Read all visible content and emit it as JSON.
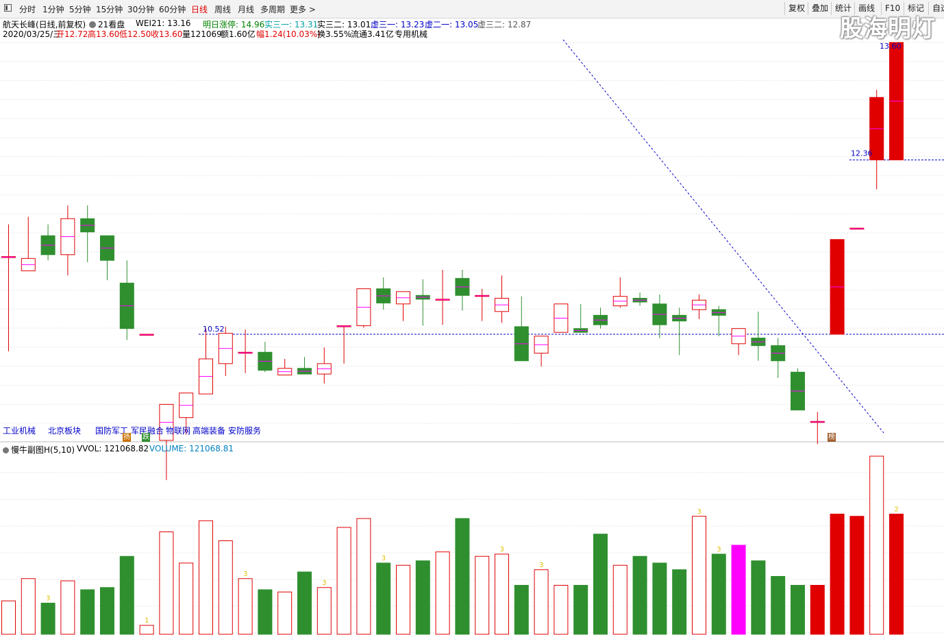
{
  "toolbar": {
    "periods": [
      "分时",
      "1分钟",
      "5分钟",
      "15分钟",
      "30分钟",
      "60分钟",
      "日线",
      "周线",
      "月线",
      "多周期",
      "更多 >"
    ],
    "active": "日线",
    "right": [
      "复权",
      "叠加",
      "统计",
      "画线",
      "F10",
      "标记",
      "自选"
    ]
  },
  "header": {
    "stock_title": "航天长峰(日线,前复权)",
    "board_btn": "21看盘",
    "wei": "WEI21: 13.16",
    "limit_up": "明日涨停: 14.96",
    "shi31": "实三一: 13.31",
    "shi32": "实三二: 13.01",
    "xu31": "虚三一: 13.23",
    "xu21": "虚二一: 13.05",
    "xu32": "虚三二: 12.87"
  },
  "quote": {
    "date": "2020/03/25/三",
    "open": "开12.72",
    "high": "高13.60",
    "low": "低12.50",
    "close": "收13.60",
    "vol": "量121069",
    "amount": "额1.60亿",
    "change": "幅1.24(10.03%)",
    "turnover": "换3.55%",
    "float": "流通3.41亿",
    "industry": "专用机械"
  },
  "chart_data": {
    "type": "candlestick",
    "price_labels": [
      "10.52",
      "12.36",
      "13.60"
    ],
    "candles": [
      {
        "o": 11.34,
        "h": 11.68,
        "l": 10.34,
        "c": 11.34
      },
      {
        "o": 11.19,
        "h": 11.76,
        "l": 11.48,
        "c": 11.32
      },
      {
        "o": 11.56,
        "h": 11.68,
        "l": 11.3,
        "c": 11.36
      },
      {
        "o": 11.36,
        "h": 11.88,
        "l": 11.14,
        "c": 11.74
      },
      {
        "o": 11.74,
        "h": 11.88,
        "l": 11.28,
        "c": 11.6
      },
      {
        "o": 11.56,
        "h": 11.56,
        "l": 11.09,
        "c": 11.3
      },
      {
        "o": 11.06,
        "h": 11.3,
        "l": 10.46,
        "c": 10.58
      },
      {
        "o": 10.52,
        "h": 10.52,
        "l": 10.52,
        "c": 10.52
      },
      {
        "o": 9.4,
        "h": 9.78,
        "l": 8.98,
        "c": 9.78
      },
      {
        "o": 9.64,
        "h": 9.9,
        "l": 9.46,
        "c": 9.9
      },
      {
        "o": 9.89,
        "h": 10.58,
        "l": 9.9,
        "c": 10.26
      },
      {
        "o": 10.21,
        "h": 10.6,
        "l": 10.08,
        "c": 10.53
      },
      {
        "o": 10.33,
        "h": 10.57,
        "l": 10.11,
        "c": 10.33
      },
      {
        "o": 10.33,
        "h": 10.44,
        "l": 10.12,
        "c": 10.14
      },
      {
        "o": 10.09,
        "h": 10.26,
        "l": 10.18,
        "c": 10.16
      },
      {
        "o": 10.16,
        "h": 10.28,
        "l": 10.14,
        "c": 10.1
      },
      {
        "o": 10.1,
        "h": 10.38,
        "l": 10.0,
        "c": 10.21
      },
      {
        "o": 10.61,
        "h": 10.34,
        "l": 10.21,
        "c": 10.61
      },
      {
        "o": 10.61,
        "h": 11.0,
        "l": 10.59,
        "c": 11.0
      },
      {
        "o": 11.0,
        "h": 11.12,
        "l": 10.78,
        "c": 10.85
      },
      {
        "o": 10.84,
        "h": 10.84,
        "l": 10.66,
        "c": 10.97
      },
      {
        "o": 10.93,
        "h": 11.1,
        "l": 10.61,
        "c": 10.89
      },
      {
        "o": 10.89,
        "h": 11.2,
        "l": 10.62,
        "c": 10.89
      },
      {
        "o": 11.11,
        "h": 11.2,
        "l": 10.77,
        "c": 10.93
      },
      {
        "o": 10.93,
        "h": 11.0,
        "l": 10.66,
        "c": 10.93
      },
      {
        "o": 10.76,
        "h": 11.14,
        "l": 10.64,
        "c": 10.9
      },
      {
        "o": 10.6,
        "h": 10.92,
        "l": 10.36,
        "c": 10.24
      },
      {
        "o": 10.32,
        "h": 10.44,
        "l": 10.18,
        "c": 10.5
      },
      {
        "o": 10.54,
        "h": 10.84,
        "l": 10.54,
        "c": 10.84
      },
      {
        "o": 10.58,
        "h": 10.84,
        "l": 10.54,
        "c": 10.54
      },
      {
        "o": 10.72,
        "h": 10.8,
        "l": 10.58,
        "c": 10.62
      },
      {
        "o": 10.82,
        "h": 11.12,
        "l": 10.8,
        "c": 10.92
      },
      {
        "o": 10.9,
        "h": 10.96,
        "l": 10.82,
        "c": 10.86
      },
      {
        "o": 10.84,
        "h": 10.94,
        "l": 10.48,
        "c": 10.62
      },
      {
        "o": 10.72,
        "h": 10.8,
        "l": 10.3,
        "c": 10.66
      },
      {
        "o": 10.78,
        "h": 10.94,
        "l": 10.68,
        "c": 10.88
      },
      {
        "o": 10.78,
        "h": 10.82,
        "l": 10.5,
        "c": 10.72
      },
      {
        "o": 10.42,
        "h": 10.56,
        "l": 10.3,
        "c": 10.58
      },
      {
        "o": 10.48,
        "h": 10.76,
        "l": 10.24,
        "c": 10.4
      },
      {
        "o": 10.4,
        "h": 10.48,
        "l": 10.06,
        "c": 10.24
      },
      {
        "o": 10.12,
        "h": 10.16,
        "l": 9.86,
        "c": 9.72
      },
      {
        "o": 9.6,
        "h": 9.7,
        "l": 9.36,
        "c": 9.6
      },
      {
        "o": 10.52,
        "h": 10.52,
        "l": 10.52,
        "c": 11.52
      },
      {
        "o": 11.64,
        "h": 11.64,
        "l": 11.64,
        "c": 11.64
      },
      {
        "o": 12.36,
        "h": 13.1,
        "l": 12.05,
        "c": 13.02
      },
      {
        "o": 12.36,
        "h": 13.6,
        "l": 12.36,
        "c": 13.6
      }
    ],
    "volume_series": {
      "name": "VOLUME",
      "label": "VOLUME: 121068.81"
    },
    "volumes": [
      30,
      50,
      28,
      48,
      40,
      42,
      70,
      8,
      92,
      64,
      102,
      84,
      50,
      40,
      38,
      56,
      42,
      96,
      104,
      64,
      62,
      66,
      74,
      104,
      70,
      72,
      44,
      58,
      44,
      44,
      90,
      62,
      70,
      64,
      58,
      106,
      72,
      80,
      66,
      52,
      44,
      44,
      108,
      106,
      160,
      108
    ],
    "indicator_title": "慢牛副图H(5,10)",
    "vvol_label": "VVOL: 121068.82"
  },
  "sectors": [
    "工业机械",
    "北京板块",
    "国防军工",
    "军民融合",
    "物联网",
    "高端装备",
    "安防服务"
  ],
  "markers": [
    "扬",
    "跌",
    "榜"
  ],
  "vol_labels": [
    "3",
    "1",
    "3",
    "3",
    "3",
    "3",
    "3",
    "3",
    "3",
    "2"
  ],
  "colors": {
    "up": "#e00000",
    "down": "#2f8f2f",
    "blue": "#0000c8",
    "magenta": "#ff00ff",
    "grid": "#e6e6e6"
  },
  "watermark": "股海明灯"
}
